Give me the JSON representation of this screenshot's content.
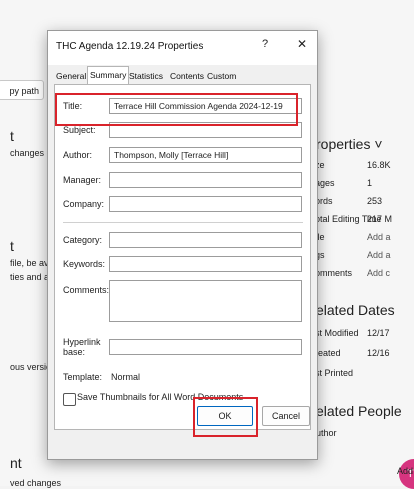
{
  "background": {
    "copy_path_label": "py path",
    "left_col": [
      "t",
      "changes p",
      "t",
      "file, be av",
      "ties and a",
      "ous versio",
      "nt",
      "ved changes"
    ],
    "properties_heading": "roperties ˅",
    "properties": [
      {
        "label": "ze",
        "value": "16.8K"
      },
      {
        "label": "ages",
        "value": "1"
      },
      {
        "label": "ords",
        "value": "253"
      },
      {
        "label": "otal Editing Time",
        "value": "217 M"
      },
      {
        "label": "tle",
        "value": "Add a"
      },
      {
        "label": "gs",
        "value": "Add a"
      },
      {
        "label": "omments",
        "value": "Add c"
      }
    ],
    "related_dates_heading": "elated Dates",
    "dates": [
      {
        "label": "st Modified",
        "value": "12/17"
      },
      {
        "label": "reated",
        "value": "12/16"
      },
      {
        "label": "st Printed",
        "value": ""
      }
    ],
    "related_people_heading": "elated People",
    "author_label": "uthor",
    "avatar_initials": "TM",
    "add_label": "Add"
  },
  "dialog": {
    "title": "THC Agenda 12.19.24 Properties",
    "help": "?",
    "close": "✕",
    "tabs": [
      "General",
      "Summary",
      "Statistics",
      "Contents",
      "Custom"
    ],
    "fields": {
      "title_label": "Title:",
      "title_value": "Terrace Hill Commission Agenda 2024-12-19",
      "subject_label": "Subject:",
      "subject_value": "",
      "author_label": "Author:",
      "author_value": "Thompson, Molly [Terrace Hill]",
      "manager_label": "Manager:",
      "manager_value": "",
      "company_label": "Company:",
      "company_value": "",
      "category_label": "Category:",
      "category_value": "",
      "keywords_label": "Keywords:",
      "keywords_value": "",
      "comments_label": "Comments:",
      "comments_value": "",
      "hyperlink_label": "Hyperlink base:",
      "hyperlink_value": "",
      "template_label": "Template:",
      "template_value": "Normal"
    },
    "thumbnail_label": "Save Thumbnails for All Word Documents",
    "ok_label": "OK",
    "cancel_label": "Cancel"
  },
  "colors": {
    "highlight": "#d9232b",
    "avatar": "#d6347f",
    "ok_border": "#0067c0"
  }
}
